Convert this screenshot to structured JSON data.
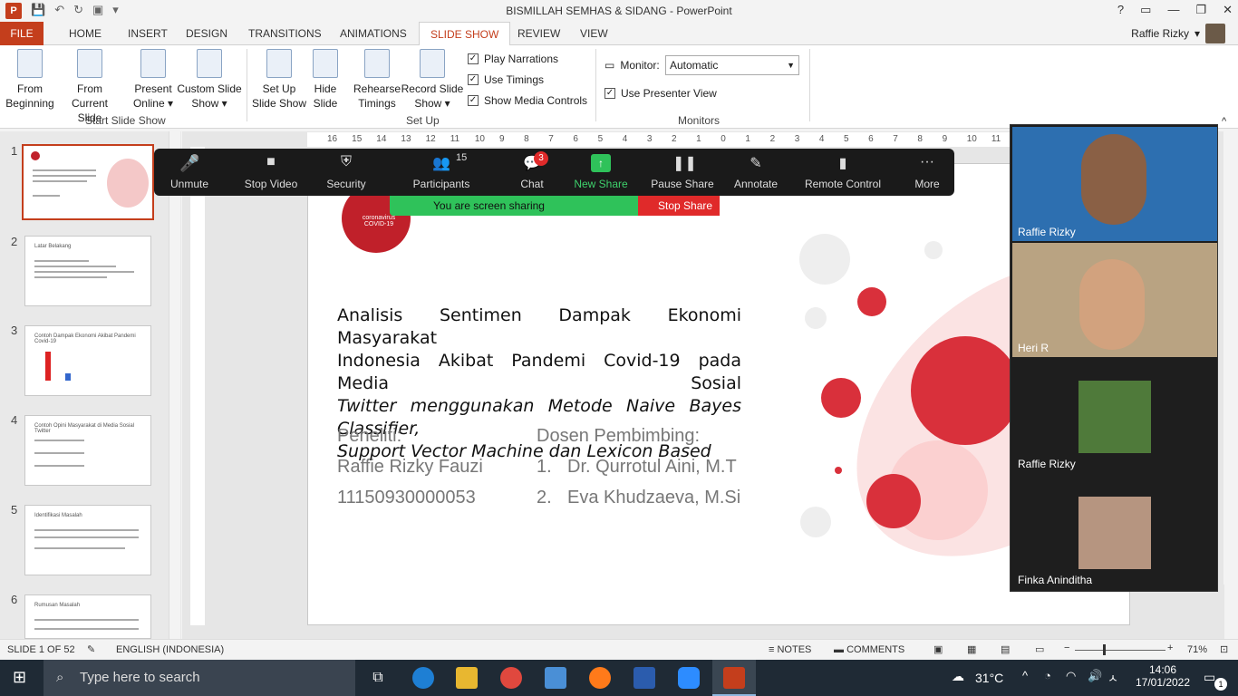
{
  "window": {
    "title": "BISMILLAH SEMHAS & SIDANG - PowerPoint",
    "app_logo": "P"
  },
  "tabs": [
    "FILE",
    "HOME",
    "INSERT",
    "DESIGN",
    "TRANSITIONS",
    "ANIMATIONS",
    "SLIDE SHOW",
    "REVIEW",
    "VIEW"
  ],
  "user": {
    "name": "Raffie Rizky"
  },
  "ribbon": {
    "from_beginning": [
      "From",
      "Beginning"
    ],
    "from_current": [
      "From",
      "Current Slide"
    ],
    "present_online": [
      "Present",
      "Online ▾"
    ],
    "custom_show": [
      "Custom Slide",
      "Show ▾"
    ],
    "group_start": "Start Slide Show",
    "setup_show": [
      "Set Up",
      "Slide Show"
    ],
    "hide_slide": [
      "Hide",
      "Slide"
    ],
    "rehearse": [
      "Rehearse",
      "Timings"
    ],
    "record": [
      "Record Slide",
      "Show ▾"
    ],
    "play_narrations": "Play Narrations",
    "use_timings": "Use Timings",
    "show_media": "Show Media Controls",
    "group_setup": "Set Up",
    "monitor_label": "Monitor:",
    "monitor_value": "Automatic",
    "presenter_view": "Use Presenter View",
    "group_monitors": "Monitors"
  },
  "thumbs": [
    {
      "num": "1",
      "title": ""
    },
    {
      "num": "2",
      "title": "Latar Belakang"
    },
    {
      "num": "3",
      "title": "Contoh Dampak Ekonomi Akibat Pandemi Covid-19"
    },
    {
      "num": "4",
      "title": "Contoh Opini Masyarakat di Media Sosial Twitter"
    },
    {
      "num": "5",
      "title": "Identifikasi Masalah"
    },
    {
      "num": "6",
      "title": "Rumusan Masalah"
    }
  ],
  "zoom": {
    "unmute": "Unmute",
    "stop_video": "Stop Video",
    "security": "Security",
    "participants": "Participants",
    "participant_count": "15",
    "chat": "Chat",
    "chat_badge": "3",
    "new_share": "New Share",
    "pause_share": "Pause Share",
    "annotate": "Annotate",
    "remote_control": "Remote Control",
    "more": "More",
    "sharing_msg": "You are screen sharing",
    "stop_share": "Stop Share"
  },
  "slide": {
    "logo_text": "coronavirus COVID-19",
    "title_lines": [
      "Analisis Sentimen Dampak Ekonomi Masyarakat",
      "Indonesia Akibat Pandemi Covid-19 pada Media Sosial",
      "Twitter menggunakan Metode Naive Bayes Classifier,",
      "Support Vector Machine dan Lexicon Based"
    ],
    "researcher_label": "Peneliti:",
    "researcher_name": "Raffie Rizky Fauzi",
    "researcher_id": "11150930000053",
    "advisor_label": "Dosen Pembimbing:",
    "advisor_1": "Dr. Qurrotul Aini, M.T",
    "advisor_2": "Eva Khudzaeva, M.Si",
    "advisor_1_num": "1.",
    "advisor_2_num": "2."
  },
  "ruler_ticks": [
    "16",
    "15",
    "14",
    "13",
    "12",
    "11",
    "10",
    "9",
    "8",
    "7",
    "6",
    "5",
    "4",
    "3",
    "2",
    "1",
    "0",
    "1",
    "2",
    "3",
    "4",
    "5",
    "6",
    "7",
    "8",
    "9",
    "10",
    "11"
  ],
  "participants": [
    {
      "name": "Raffie Rizky",
      "muted": true
    },
    {
      "name": "Heri R",
      "muted": false
    },
    {
      "name": "Raffie Rizky",
      "muted": false
    },
    {
      "name": "Finka Aninditha",
      "muted": true
    }
  ],
  "status": {
    "slide_info": "SLIDE 1 OF 52",
    "language": "ENGLISH (INDONESIA)",
    "notes": "NOTES",
    "comments": "COMMENTS",
    "zoom": "71%"
  },
  "taskbar": {
    "search_placeholder": "Type here to search",
    "temp": "31°C",
    "time": "14:06",
    "date": "17/01/2022",
    "notif": "1"
  }
}
